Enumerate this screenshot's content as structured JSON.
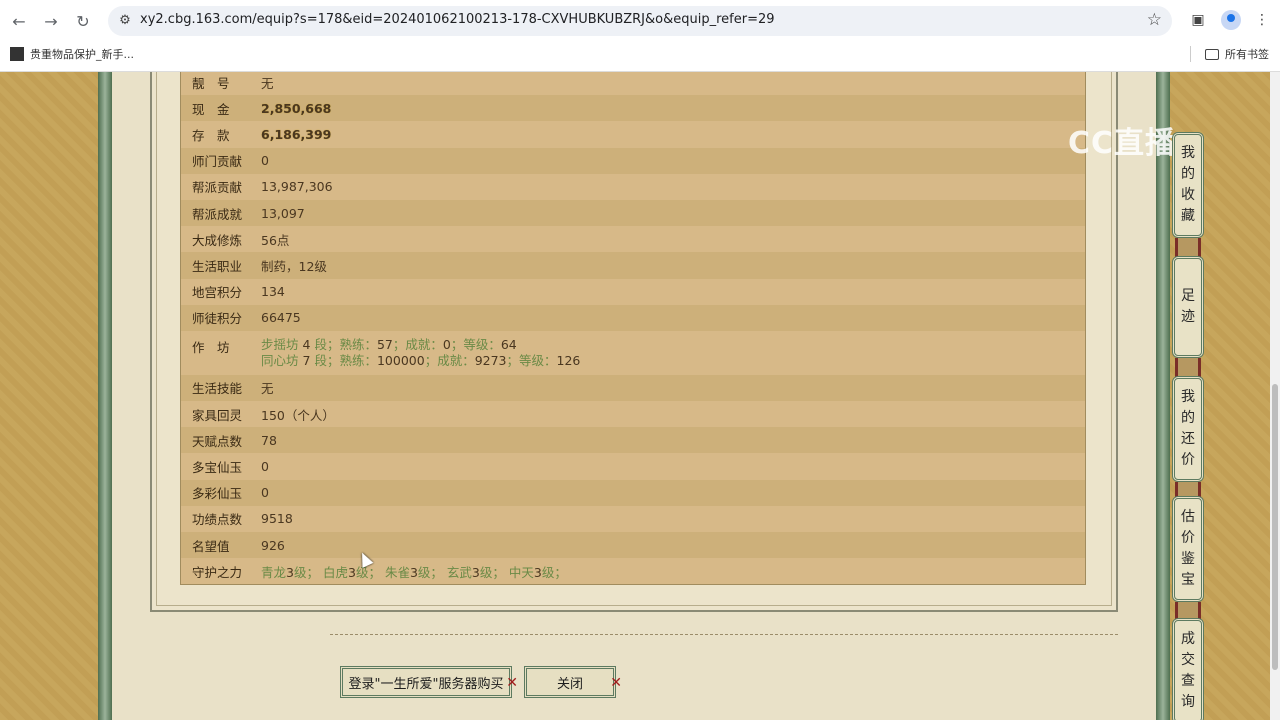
{
  "browser": {
    "url": "xy2.cbg.163.com/equip?s=178&eid=202401062100213-178-CXVHUBKUBZRJ&o&equip_refer=29",
    "bookmark_label": "贵重物品保护_新手...",
    "all_bookmarks_label": "所有书签"
  },
  "watermark": "CC直播",
  "rows": [
    {
      "label": "靓　号",
      "value": "无",
      "style": "dark"
    },
    {
      "label": "现　金",
      "value": "2,850,668",
      "style": "gold"
    },
    {
      "label": "存　款",
      "value": "6,186,399",
      "style": "gold"
    },
    {
      "label": "师门贡献",
      "value": "0",
      "style": "dark"
    },
    {
      "label": "帮派贡献",
      "value": "13,987,306",
      "style": "dark"
    },
    {
      "label": "帮派成就",
      "value": "13,097",
      "style": "dark"
    },
    {
      "label": "大成修炼",
      "value": "56点",
      "style": "dark"
    },
    {
      "label": "生活职业",
      "value": "制药，12级",
      "style": "dark"
    }
  ],
  "rows2": [
    {
      "label": "地宫积分",
      "value": "134"
    },
    {
      "label": "师徒积分",
      "value": "66475"
    }
  ],
  "workshop": {
    "label": "作　坊",
    "line1": {
      "name": "步摇坊",
      "level": "4",
      "seg": "段；",
      "p1": "熟练：",
      "v1": "57",
      "p2": "；成就：",
      "v2": "0",
      "p3": "；等级：",
      "v3": "64"
    },
    "line2": {
      "name": "同心坊",
      "level": "7",
      "seg": "段；",
      "p1": "熟练：",
      "v1": "100000",
      "p2": "；成就：",
      "v2": "9273",
      "p3": "；等级：",
      "v3": "126"
    }
  },
  "rows3": [
    {
      "label": "生活技能",
      "value": "无"
    },
    {
      "label": "家具回灵",
      "value": "150（个人）"
    },
    {
      "label": "天赋点数",
      "value": "78"
    },
    {
      "label": "多宝仙玉",
      "value": "0"
    },
    {
      "label": "多彩仙玉",
      "value": "0"
    },
    {
      "label": "功绩点数",
      "value": "9518"
    },
    {
      "label": "名望值",
      "value": "926"
    }
  ],
  "guardian": {
    "label": "守护之力",
    "items": [
      {
        "name": "青龙",
        "level": "3",
        "suffix": "级；"
      },
      {
        "name": "白虎",
        "level": "3",
        "suffix": "级；"
      },
      {
        "name": "朱雀",
        "level": "3",
        "suffix": "级；"
      },
      {
        "name": "玄武",
        "level": "3",
        "suffix": "级；"
      },
      {
        "name": "中天",
        "level": "3",
        "suffix": "级；"
      }
    ]
  },
  "buttons": {
    "login_buy": "登录\"一生所爱\"服务器购买",
    "close": "关闭"
  },
  "side_tabs": [
    {
      "chars": [
        "我",
        "的",
        "收",
        "藏"
      ]
    },
    {
      "chars": [
        "足",
        "迹"
      ]
    },
    {
      "chars": [
        "我",
        "的",
        "还",
        "价"
      ]
    },
    {
      "chars": [
        "估",
        "价",
        "鉴",
        "宝"
      ]
    },
    {
      "chars": [
        "成",
        "交",
        "查",
        "询"
      ]
    }
  ]
}
